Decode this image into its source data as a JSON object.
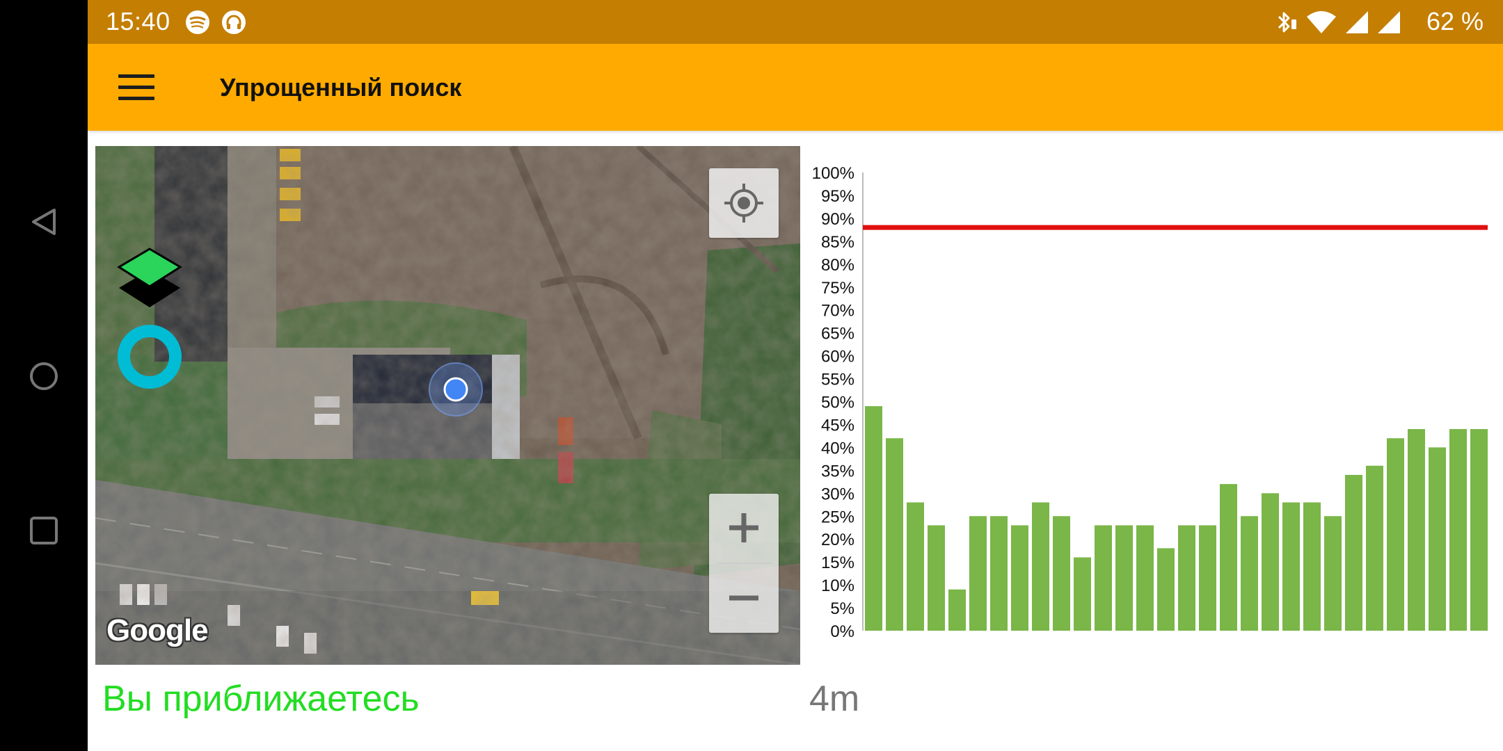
{
  "status_bar": {
    "time": "15:40",
    "battery": "62 %",
    "icons": [
      "spotify-icon",
      "headphones-icon",
      "bluetooth-icon",
      "wifi-icon",
      "signal-icon",
      "signal-icon"
    ]
  },
  "app_bar": {
    "title": "Упрощенный поиск",
    "menu_icon": "hamburger-menu-icon"
  },
  "map": {
    "attribution": "Google",
    "controls": [
      "my-location-icon",
      "zoom-in-icon",
      "zoom-out-icon",
      "layers-icon",
      "circle-icon"
    ]
  },
  "status": {
    "message": "Вы приближаетесь",
    "message_color": "#22DD22",
    "distance": "4m"
  },
  "colors": {
    "status_bar": "#C47E02",
    "app_bar": "#FFAA00",
    "bars": "#7AB648",
    "threshold": "#E01010"
  },
  "chart_data": {
    "type": "bar",
    "ylim": [
      0,
      100
    ],
    "y_ticks": [
      "0%",
      "5%",
      "10%",
      "15%",
      "20%",
      "25%",
      "30%",
      "35%",
      "40%",
      "45%",
      "50%",
      "55%",
      "60%",
      "65%",
      "70%",
      "75%",
      "80%",
      "85%",
      "90%",
      "95%",
      "100%"
    ],
    "values": [
      49,
      42,
      28,
      23,
      9,
      25,
      25,
      23,
      28,
      25,
      16,
      23,
      23,
      23,
      18,
      23,
      23,
      32,
      25,
      30,
      28,
      28,
      25,
      34,
      36,
      42,
      44,
      40,
      44,
      44
    ],
    "threshold": 88,
    "grid": false,
    "legend": "none"
  }
}
